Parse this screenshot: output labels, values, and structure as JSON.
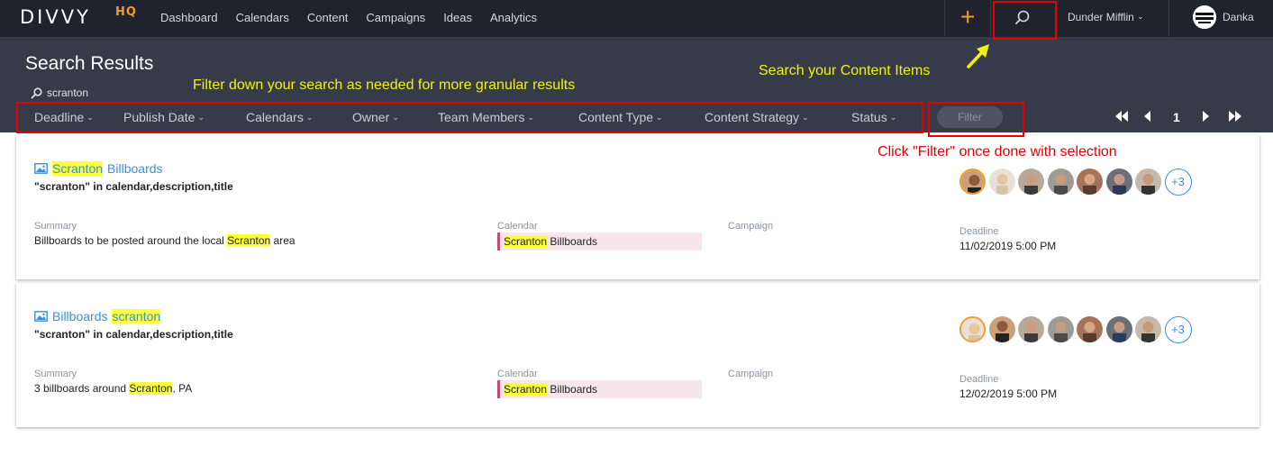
{
  "app": {
    "logo": "DIVVY",
    "logo_suffix": "HQ"
  },
  "nav": {
    "links": [
      "Dashboard",
      "Calendars",
      "Content",
      "Campaigns",
      "Ideas",
      "Analytics"
    ]
  },
  "header": {
    "plus_label": "+",
    "org": "Dunder Mifflin",
    "user": "Danka"
  },
  "page": {
    "title": "Search Results",
    "query": "scranton"
  },
  "filters": {
    "items": [
      "Deadline",
      "Publish Date",
      "Calendars",
      "Owner",
      "Team Members",
      "Content Type",
      "Content Strategy",
      "Status"
    ],
    "button": "Filter"
  },
  "pagination": {
    "current": "1"
  },
  "annotations": {
    "filter_hint": "Filter down your search as needed for more granular results",
    "search_hint": "Search your Content Items",
    "filter_click_hint": "Click \"Filter\" once done with selection"
  },
  "labels": {
    "summary": "Summary",
    "calendar": "Calendar",
    "campaign": "Campaign",
    "deadline": "Deadline"
  },
  "results": [
    {
      "title_a": "Scranton",
      "title_b": "Billboards",
      "match": "\"scranton\" in calendar,description,title",
      "summary_a": "Billboards to be posted around the local ",
      "summary_hl": "Scranton",
      "summary_b": " area",
      "calendar_hl": "Scranton",
      "calendar_b": " Billboards",
      "deadline": "11/02/2019 5:00 PM",
      "more": "+3"
    },
    {
      "title_a": "Billboards",
      "title_b": "scranton",
      "match": "\"scranton\" in calendar,description,title",
      "summary_a": "3 billboards around ",
      "summary_hl": "Scranton",
      "summary_b": ", PA",
      "calendar_hl": "Scranton",
      "calendar_b": " Billboards",
      "deadline": "12/02/2019 5:00 PM",
      "more": "+3"
    }
  ],
  "colors": {
    "nav_bg": "#20232e",
    "subhead_bg": "#373b49",
    "accent": "#f39a2a",
    "link": "#3a8fd6",
    "annotation_red": "#e60000",
    "annotation_yellow": "#f2f20a",
    "highlight": "#fbff3d"
  }
}
